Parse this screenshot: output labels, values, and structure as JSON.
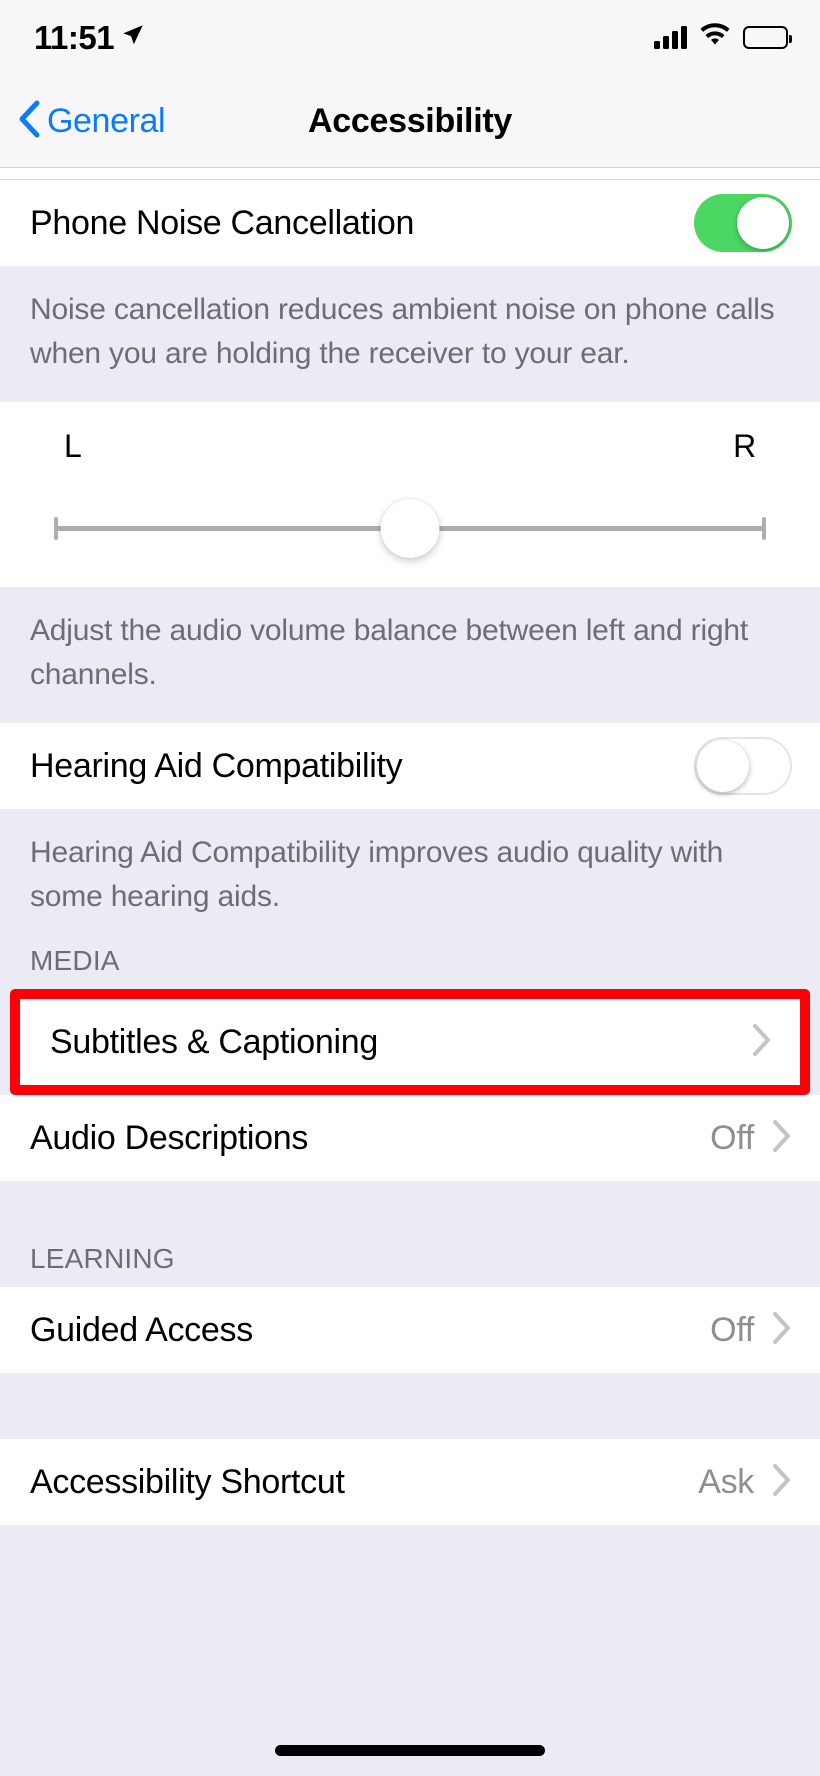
{
  "status_bar": {
    "time": "11:51",
    "location_icon": "location-arrow-icon",
    "signal_icon": "cellular-signal-icon",
    "wifi_icon": "wifi-icon",
    "battery_icon": "battery-full-icon"
  },
  "nav": {
    "back_label": "General",
    "back_icon": "chevron-left-icon",
    "title": "Accessibility"
  },
  "colors": {
    "accent_blue": "#0a7aff",
    "toggle_on_green": "#4cd763",
    "highlight_red": "#fb0007",
    "group_background": "#ecebf3",
    "cell_background": "#ffffff",
    "secondary_text": "#8e8e93"
  },
  "sections": {
    "phone_noise": {
      "label": "Phone Noise Cancellation",
      "toggle_state": "on",
      "footer": "Noise cancellation reduces ambient noise on phone calls when you are holding the receiver to your ear."
    },
    "balance": {
      "left_label": "L",
      "right_label": "R",
      "value": "0",
      "footer": "Adjust the audio volume balance between left and right channels."
    },
    "hearing_aid": {
      "label": "Hearing Aid Compatibility",
      "toggle_state": "off",
      "footer": "Hearing Aid Compatibility improves audio quality with some hearing aids."
    },
    "media": {
      "header": "MEDIA",
      "rows": [
        {
          "label": "Subtitles & Captioning",
          "value": "",
          "highlighted": true
        },
        {
          "label": "Audio Descriptions",
          "value": "Off",
          "highlighted": false
        }
      ]
    },
    "learning": {
      "header": "LEARNING",
      "rows": [
        {
          "label": "Guided Access",
          "value": "Off"
        }
      ]
    },
    "shortcut": {
      "rows": [
        {
          "label": "Accessibility Shortcut",
          "value": "Ask"
        }
      ]
    }
  },
  "home_indicator": "home-indicator"
}
